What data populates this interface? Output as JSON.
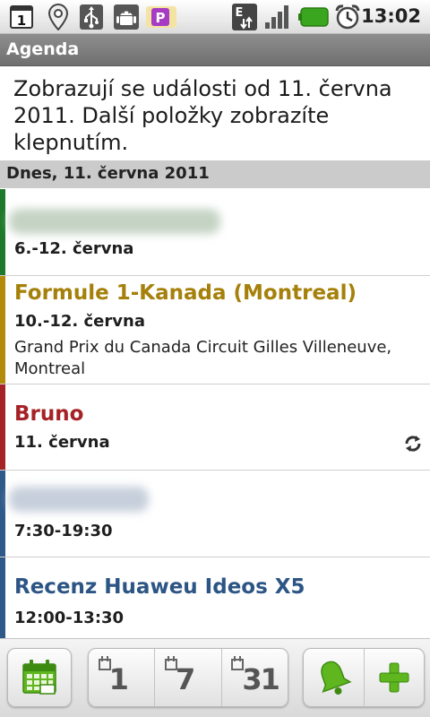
{
  "status_bar": {
    "time": "13:02",
    "notification_count": "1",
    "network_type": "E",
    "icons": [
      "notification-icon",
      "location-icon",
      "usb-icon",
      "android-debug-icon",
      "parking-app-icon",
      "edge-network-icon",
      "signal-icon",
      "battery-icon",
      "alarm-icon"
    ],
    "battery_color": "#3aa51f"
  },
  "header": {
    "title": "Agenda"
  },
  "info_text": "Zobrazují se události od 11. června 2011. Další položky zobrazíte klepnutím.",
  "day_header": "Dnes, 11. června 2011",
  "events": [
    {
      "title": "",
      "time": "6.-12. června",
      "location": "",
      "color": "#1e7a2a",
      "title_blurred": true
    },
    {
      "title": "Formule 1-Kanada (Montreal)",
      "time": "10.-12. června",
      "location": "Grand Prix du Canada Circuit Gilles Villeneuve, Montreal",
      "color": "#b38a0a",
      "title_blurred": false
    },
    {
      "title": "Bruno",
      "time": "11. června",
      "location": "",
      "color": "#a52226",
      "title_blurred": false,
      "repeat_icon": "sync-icon"
    },
    {
      "title": "",
      "time": "7:30-19:30",
      "location": "",
      "color": "#2e5a8a",
      "title_blurred": true
    },
    {
      "title": "Recenz Huaweu Ideos X5",
      "time": "12:00-13:30",
      "location": "",
      "color": "#2e5a8a",
      "title_blurred": false
    }
  ],
  "toolbar": {
    "agenda_button": {
      "icon": "agenda-calendar-icon"
    },
    "view_buttons": [
      {
        "label": "1",
        "icon": "day-view-icon"
      },
      {
        "label": "7",
        "icon": "week-view-icon"
      },
      {
        "label": "31",
        "icon": "month-view-icon"
      }
    ],
    "alarm_button": {
      "icon": "bell-icon"
    },
    "add_button": {
      "icon": "add-icon"
    },
    "accent_green": "#5fb61e"
  }
}
